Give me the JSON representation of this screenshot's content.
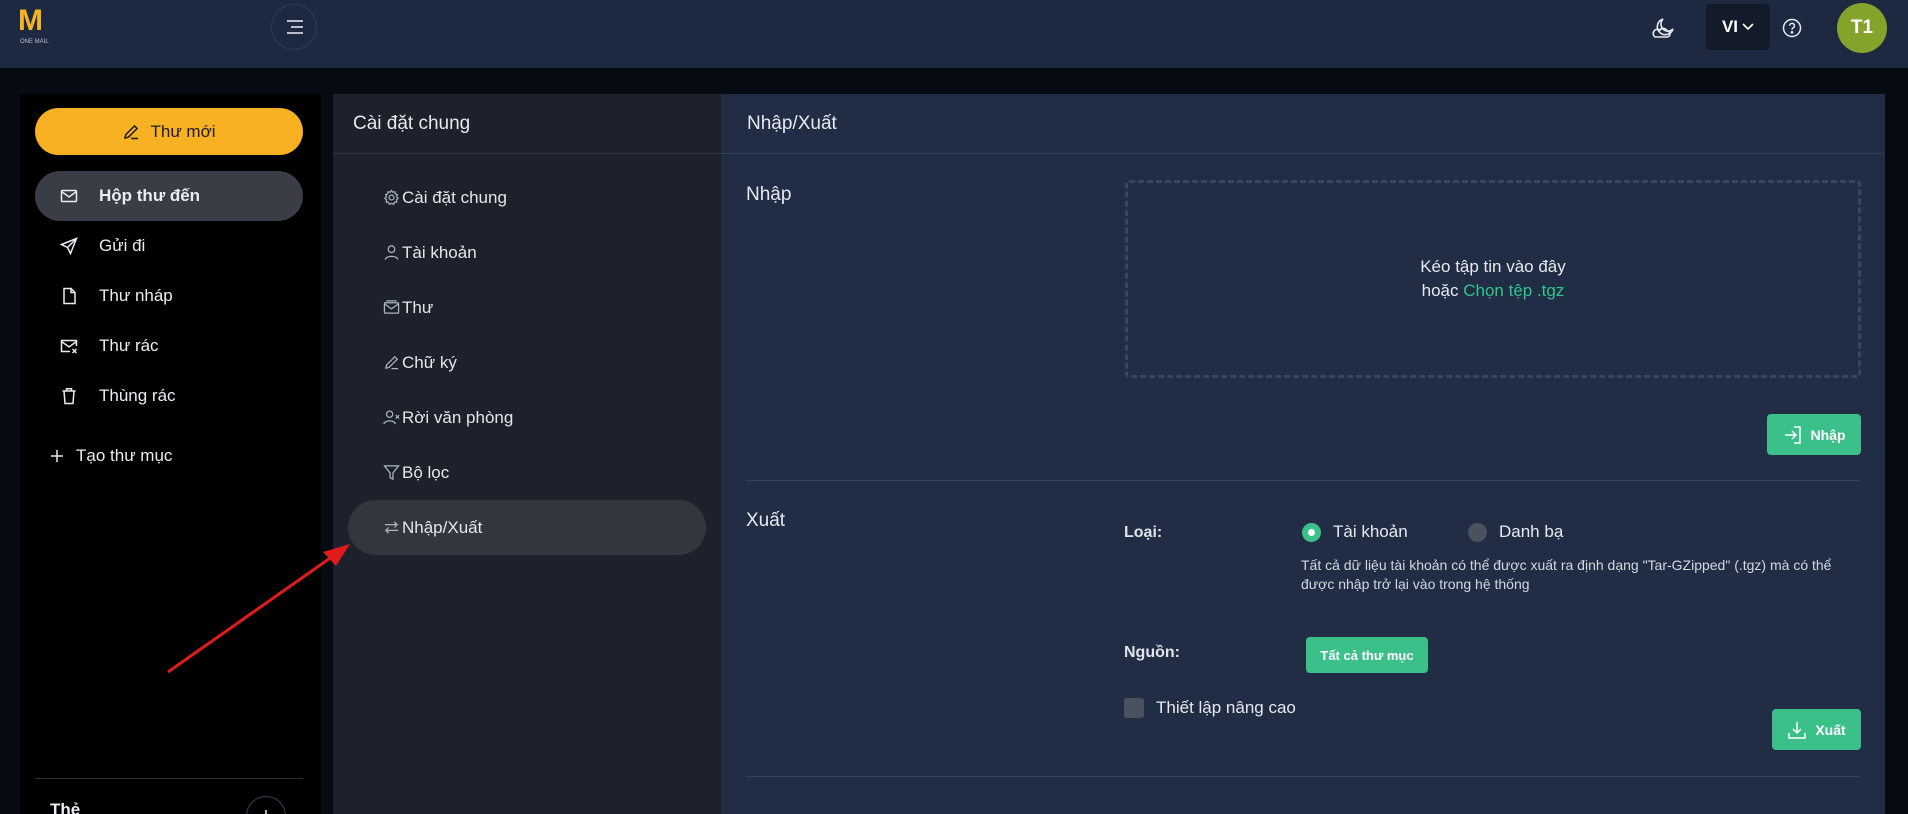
{
  "header": {
    "logo_mark": "M",
    "logo_sub": "ONE MAIL",
    "language": "VI",
    "avatar_initials": "T1"
  },
  "sidebar": {
    "compose_label": "Thư mới",
    "items": [
      {
        "label": "Hộp thư đến",
        "icon": "mail-icon",
        "active": true
      },
      {
        "label": "Gửi đi",
        "icon": "send-icon"
      },
      {
        "label": "Thư nháp",
        "icon": "draft-icon"
      },
      {
        "label": "Thư rác",
        "icon": "spam-icon"
      },
      {
        "label": "Thùng rác",
        "icon": "trash-icon"
      }
    ],
    "new_folder_label": "Tạo thư mục",
    "tags_label": "Thẻ"
  },
  "settings": {
    "title": "Cài đặt chung",
    "items": [
      {
        "label": "Cài đặt chung",
        "icon": "gear-icon"
      },
      {
        "label": "Tài khoản",
        "icon": "user-icon"
      },
      {
        "label": "Thư",
        "icon": "mail-stack-icon"
      },
      {
        "label": "Chữ ký",
        "icon": "pen-icon"
      },
      {
        "label": "Rời văn phòng",
        "icon": "user-x-icon"
      },
      {
        "label": "Bộ lọc",
        "icon": "filter-icon"
      },
      {
        "label": "Nhập/Xuất",
        "icon": "swap-icon",
        "active": true
      }
    ]
  },
  "content": {
    "title": "Nhập/Xuất",
    "import": {
      "title": "Nhập",
      "drop_text": "Kéo tập tin vào đây",
      "or_text": "hoặc",
      "choose_link": "Chọn tệp .tgz",
      "button_label": "Nhập"
    },
    "export": {
      "title": "Xuất",
      "type_label": "Loại:",
      "options": [
        {
          "label": "Tài khoản",
          "selected": true
        },
        {
          "label": "Danh bạ",
          "selected": false
        }
      ],
      "description": "Tất cả dữ liệu tài khoản có thể được xuất ra định dạng \"Tar-GZipped\" (.tgz) mà có thể được nhập trở lại vào trong hệ thống",
      "source_label": "Nguồn:",
      "source_button": "Tất cả thư mục",
      "advanced_label": "Thiết lập nâng cao",
      "button_label": "Xuất"
    }
  },
  "colors": {
    "accent_yellow": "#f8b123",
    "accent_green": "#3cc08a",
    "header_bg": "#1d2940",
    "content_bg": "#212d45",
    "annotation_arrow": "#e01b1b"
  }
}
